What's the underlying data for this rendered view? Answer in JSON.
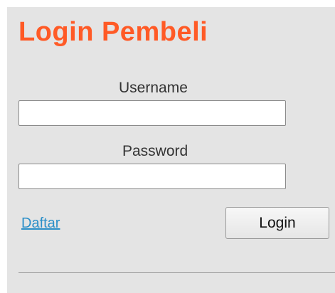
{
  "login_form": {
    "title": "Login Pembeli",
    "username_label": "Username",
    "username_value": "",
    "password_label": "Password",
    "password_value": "",
    "register_link": "Daftar",
    "login_button": "Login"
  },
  "colors": {
    "title": "#ff5a26",
    "panel_background": "#e4e4e4",
    "link": "#2b8fc8"
  }
}
